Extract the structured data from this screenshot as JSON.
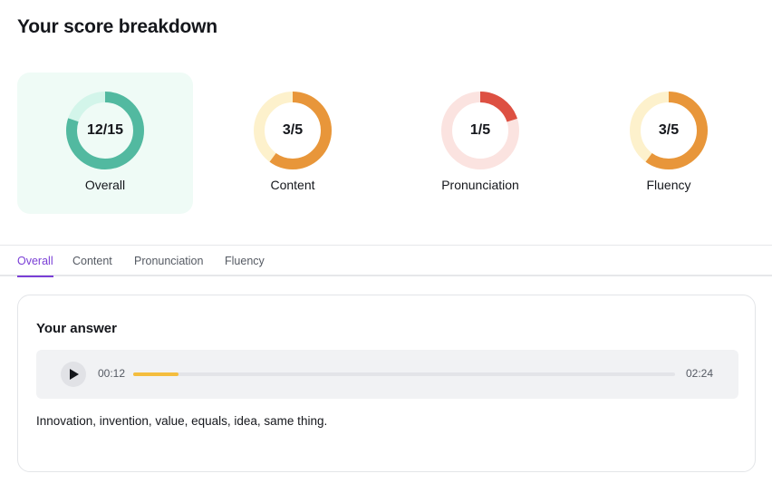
{
  "page": {
    "title": "Your score breakdown"
  },
  "scores": [
    {
      "label": "Overall",
      "value_text": "12/15",
      "score": 12,
      "max": 15,
      "color": "#52b9a0",
      "track_color": "#d3f5ea",
      "active": true
    },
    {
      "label": "Content",
      "value_text": "3/5",
      "score": 3,
      "max": 5,
      "color": "#e8963a",
      "track_color": "#fdf1cc",
      "active": false
    },
    {
      "label": "Pronunciation",
      "value_text": "1/5",
      "score": 1,
      "max": 5,
      "color": "#dd5042",
      "track_color": "#fbe3e0",
      "active": false
    },
    {
      "label": "Fluency",
      "value_text": "3/5",
      "score": 3,
      "max": 5,
      "color": "#e8963a",
      "track_color": "#fdf1cc",
      "active": false
    }
  ],
  "tabs": [
    {
      "label": "Overall",
      "active": true
    },
    {
      "label": "Content",
      "active": false
    },
    {
      "label": "Pronunciation",
      "active": false
    },
    {
      "label": "Fluency",
      "active": false
    }
  ],
  "answer": {
    "title": "Your answer",
    "player": {
      "play_icon": "play-icon",
      "current_time": "00:12",
      "total_time": "02:24",
      "progress": 0.0833,
      "progress_color": "#f4bd3e"
    },
    "transcript": "Innovation, invention, value, equals, idea, same thing."
  },
  "colors": {
    "accent": "#7a3fd6",
    "active_card_bg": "#effbf6"
  }
}
